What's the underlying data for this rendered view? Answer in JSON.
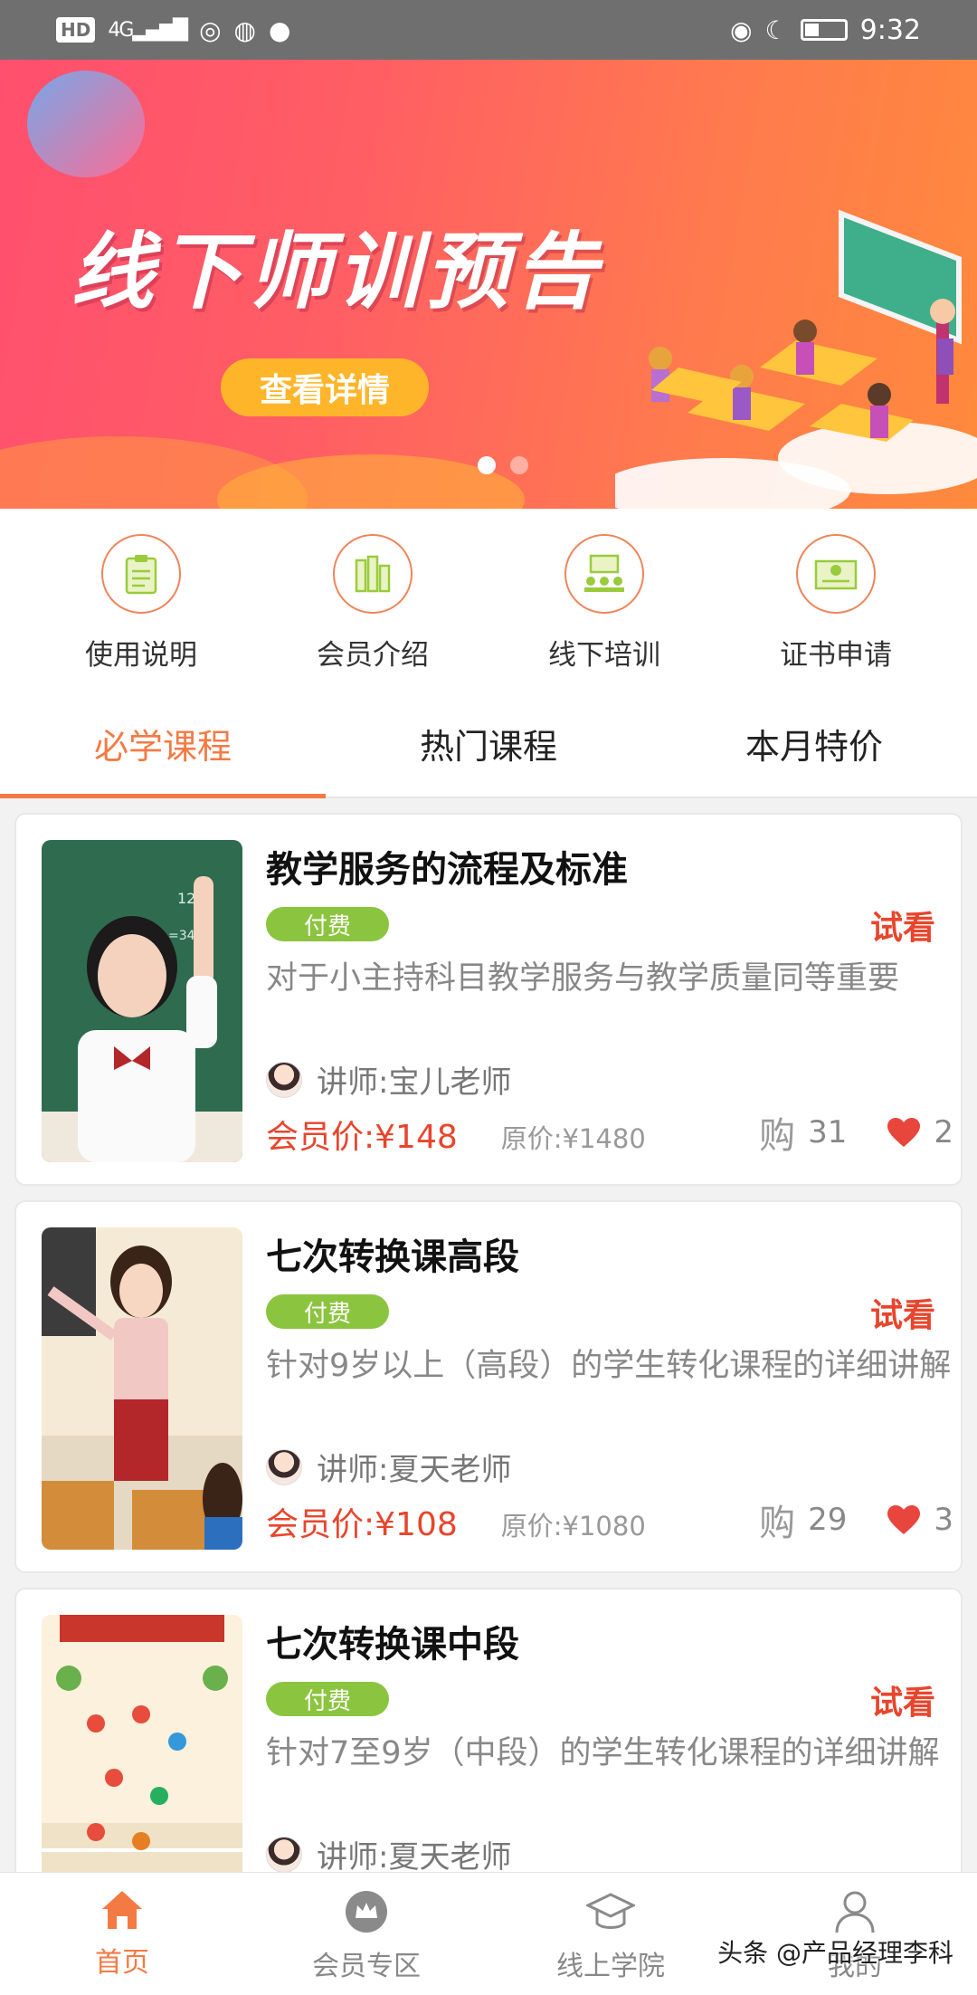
{
  "status_bar": {
    "network_badge": "HD",
    "network_type": "4G",
    "time": "9:32",
    "battery_level": 0.35
  },
  "banner": {
    "title": "线下师训预告",
    "button_label": "查看详情",
    "slides_total": 2,
    "active_slide": 1
  },
  "quick_menu": [
    {
      "label": "使用说明",
      "icon": "clipboard-icon"
    },
    {
      "label": "会员介绍",
      "icon": "books-icon"
    },
    {
      "label": "线下培训",
      "icon": "classroom-icon"
    },
    {
      "label": "证书申请",
      "icon": "certificate-icon"
    }
  ],
  "tabs": [
    {
      "label": "必学课程",
      "active": true
    },
    {
      "label": "热门课程",
      "active": false
    },
    {
      "label": "本月特价",
      "active": false
    }
  ],
  "courses": [
    {
      "title": "教学服务的流程及标准",
      "badge": "付费",
      "trial": "试看",
      "desc": "对于小主持科目教学服务与教学质量同等重要",
      "teacher": "讲师:宝儿老师",
      "member_price": "会员价:¥148",
      "original_price": "原价:¥1480",
      "buy_icon_text": "购",
      "purchases": "31",
      "likes": "2"
    },
    {
      "title": "七次转换课高段",
      "badge": "付费",
      "trial": "试看",
      "desc": "针对9岁以上（高段）的学生转化课程的详细讲解",
      "teacher": "讲师:夏天老师",
      "member_price": "会员价:¥108",
      "original_price": "原价:¥1080",
      "buy_icon_text": "购",
      "purchases": "29",
      "likes": "3"
    },
    {
      "title": "七次转换课中段",
      "badge": "付费",
      "trial": "试看",
      "desc": "针对7至9岁（中段）的学生转化课程的详细讲解",
      "teacher": "讲师:夏天老师",
      "member_price": "",
      "original_price": "",
      "buy_icon_text": "",
      "purchases": "",
      "likes": ""
    }
  ],
  "bottom_nav": [
    {
      "label": "首页",
      "icon": "home-icon",
      "active": true
    },
    {
      "label": "会员专区",
      "icon": "crown-icon",
      "active": false
    },
    {
      "label": "线上学院",
      "icon": "graduation-cap-icon",
      "active": false
    },
    {
      "label": "我的",
      "icon": "user-icon",
      "active": false
    }
  ],
  "watermark": "头条 @产品经理李科",
  "colors": {
    "accent": "#f47a44",
    "price_red": "#e8452c",
    "badge_green": "#8bc53f",
    "heart_red": "#e8453c"
  }
}
